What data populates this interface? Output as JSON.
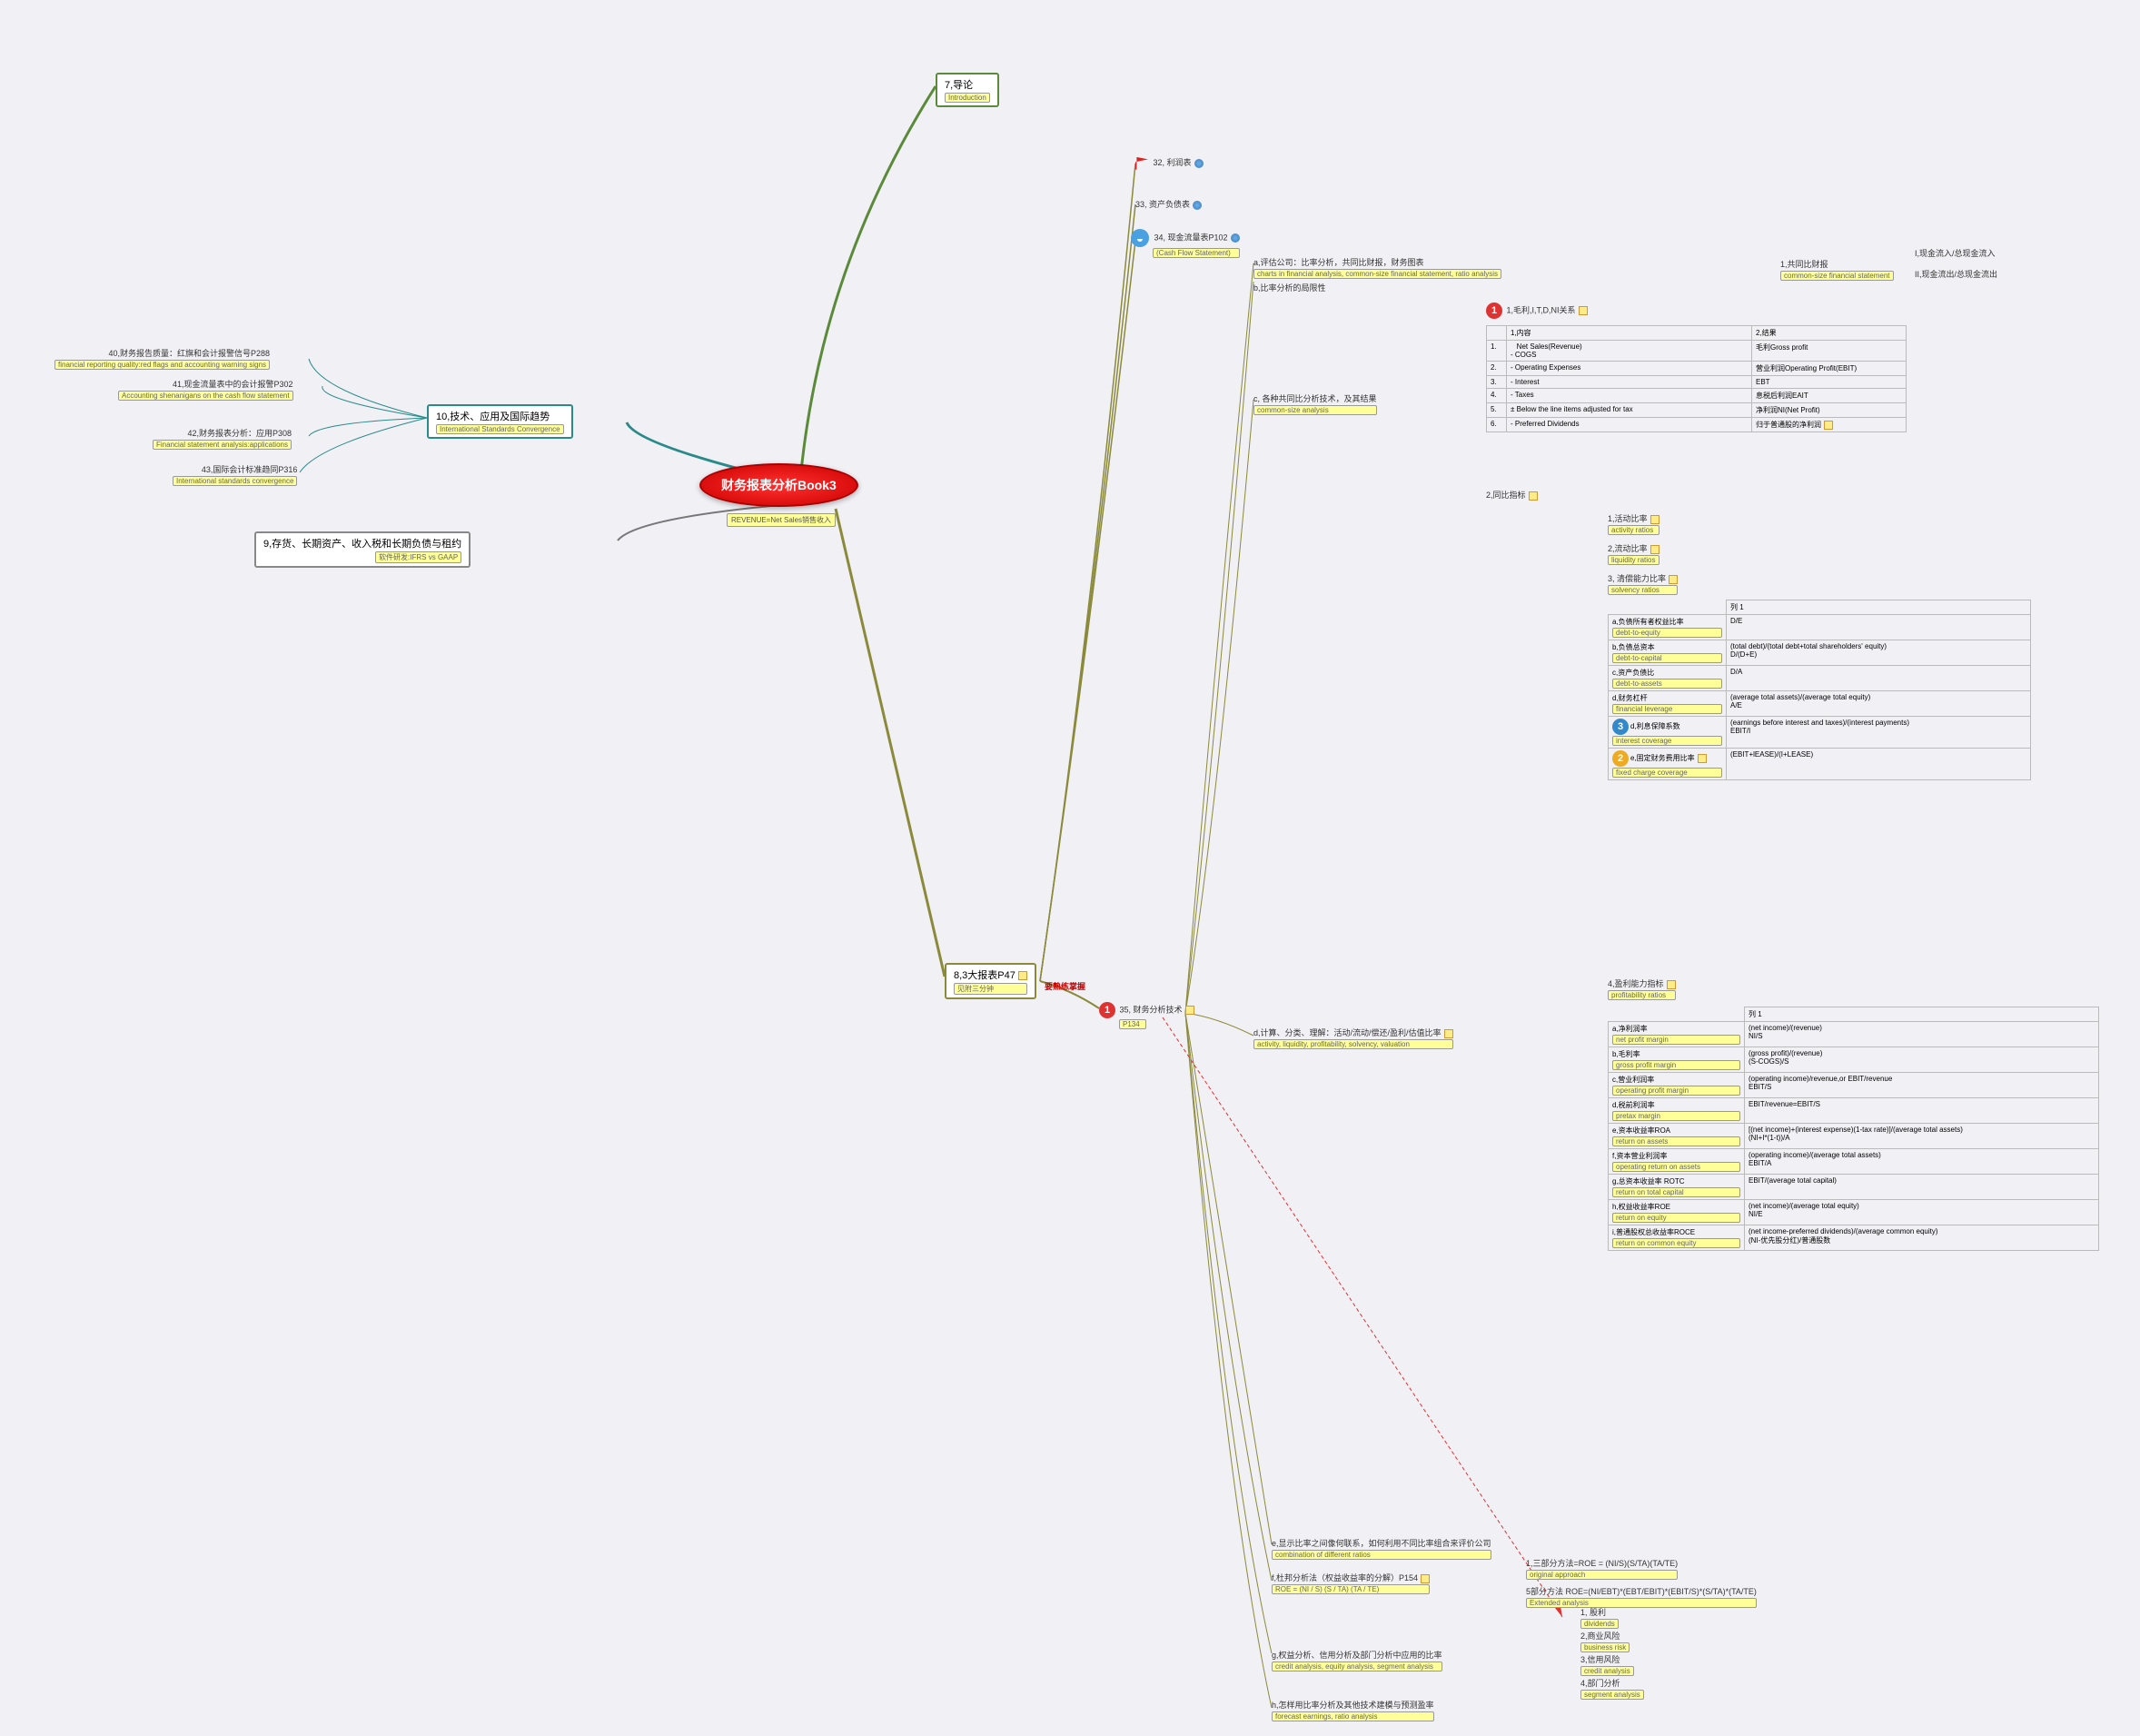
{
  "center": {
    "title": "财务报表分析Book3",
    "subtitle": "REVENUE=Net Sales销售收入"
  },
  "branch7": {
    "title": "7,导论",
    "sub": "Introduction"
  },
  "branch8": {
    "title": "8,3大报表P47",
    "sub": "见附三分钟",
    "annotation": "要熟练掌握"
  },
  "branch9": {
    "title": "9,存货、长期资产、收入税和长期负债与租约",
    "sub": "软件研发:IFRS vs GAAP"
  },
  "branch10": {
    "title": "10,技术、应用及国际趋势",
    "sub": "International Standards Convergence"
  },
  "b10_items": [
    {
      "t": "40,财务报告质量：红旗和会计报警信号P288",
      "s": "financial reporting quality:red flags and accounting warning signs"
    },
    {
      "t": "41,现金流量表中的会计报警P302",
      "s": "Accounting shenanigans on the cash flow statement"
    },
    {
      "t": "42,财务报表分析：应用P308",
      "s": "Financial statement analysis:applications"
    },
    {
      "t": "43,国际会计标准趋同P316",
      "s": "International standards convergence"
    }
  ],
  "b8_items": {
    "32": "32, 利润表",
    "33": "33, 资产负债表",
    "34": {
      "t": "34, 现金流量表P102",
      "s": "(Cash Flow Statement)"
    },
    "35": {
      "t": "35, 财务分析技术",
      "s": "P134"
    }
  },
  "n35_a": {
    "t": "a,评估公司：比率分析，共同比财报，财务图表",
    "s": "charts in financial analysis, common-size financial statement, ratio analysis"
  },
  "n35_a1": {
    "t": "1,共同比财报",
    "s": "common-size financial statement"
  },
  "n35_a1_I": "I,现金流入/总现金流入",
  "n35_a1_II": "II,现金流出/总现金流出",
  "n35_b": "b,比率分析的局限性",
  "n35_c": {
    "t": "c, 各种共同比分析技术，及其结果",
    "s": "common-size analysis"
  },
  "n35_c1": {
    "t": "1,毛利,I,T,D,NI关系"
  },
  "table1": {
    "headers": [
      "1,内容",
      "2,结果"
    ],
    "rows": [
      [
        "1.",
        "Net Sales(Revenue)\n- COGS",
        "毛利Gross profit"
      ],
      [
        "2.",
        "- Operating Expenses",
        "营业利润Operating Profit(EBIT)"
      ],
      [
        "3.",
        "- Interest",
        "EBT"
      ],
      [
        "4.",
        "- Taxes",
        "息税后利润EAIT"
      ],
      [
        "5.",
        "± Below the line items adjusted for tax",
        "净利润NI(Net Profit)"
      ],
      [
        "6.",
        "- Preferred Dividends",
        "归于普通股的净利润"
      ]
    ]
  },
  "n35_c2": "2,同比指标",
  "ratios_nav": [
    {
      "t": "1,活动比率",
      "s": "activity ratios"
    },
    {
      "t": "2,流动比率",
      "s": "liquidity ratios"
    },
    {
      "t": "3, 清偿能力比率",
      "s": "solvency ratios"
    },
    {
      "t": "4,盈利能力指标",
      "s": "profitability ratios"
    }
  ],
  "solvency_table": {
    "header": "列 1",
    "rows": [
      {
        "n": "a,负债所有者权益比率",
        "s": "debt-to-equity",
        "v": "D/E"
      },
      {
        "n": "b,负债总资本",
        "s": "debt-to-capital",
        "v": "(total debt)/(total debt+total shareholders' equity)\nD/(D+E)"
      },
      {
        "n": "c,资产负债比",
        "s": "debt-to-assets",
        "v": "D/A"
      },
      {
        "n": "d,财务杠杆",
        "s": "financial leverage",
        "v": "(average total assets)/(average total equity)\nA/E"
      },
      {
        "n": "d,利息保障系数",
        "s": "interest coverage",
        "v": "(earnings before interest and taxes)/(interest payments)\nEBIT/I",
        "icon": "3"
      },
      {
        "n": "e,固定财务费用比率",
        "s": "fixed charge coverage",
        "v": "(EBIT+lEASE)/(I+LEASE)",
        "icon": "2"
      }
    ]
  },
  "profit_table": {
    "header": "列 1",
    "rows": [
      {
        "n": "a,净利润率",
        "s": "net profit margin",
        "v": "(net income)/(revenue)\nNI/S"
      },
      {
        "n": "b,毛利率",
        "s": "gross profit margin",
        "v": "(gross profit)/(revenue)\n(S-COGS)/S"
      },
      {
        "n": "c,营业利润率",
        "s": "operating profit margin",
        "v": "(operating income)/revenue,or EBIT/revenue\nEBIT/S"
      },
      {
        "n": "d,税前利润率",
        "s": "pretax margin",
        "v": "EBIT/revenue=EBIT/S"
      },
      {
        "n": "e,资本收益率ROA",
        "s": "return on assets",
        "v": "[(net income)+(interest expense)(1-tax rate)]/(average total assets)\n(NI+I*(1-t))/A"
      },
      {
        "n": "f,资本营业利润率",
        "s": "operating return on assets",
        "v": "(operating income)/(average total assets)\nEBIT/A"
      },
      {
        "n": "g,总资本收益率 ROTC",
        "s": "return on total capital",
        "v": "EBIT/(average total capital)"
      },
      {
        "n": "h,权益收益率ROE",
        "s": "return on equity",
        "v": "(net income)/(average total equity)\nNI/E"
      },
      {
        "n": "i,普通股权总收益率ROCE",
        "s": "return on common equity",
        "v": "(net income-preferred dividends)/(average common equity)\n(NI-优先股分红)/普通股数"
      }
    ]
  },
  "n35_d": {
    "t": "d,计算、分类、理解：活动/流动/偿还/盈利/估值比率",
    "s": "activity, liquidity, profitability, solvency, valuation"
  },
  "n35_e": {
    "t": "e,显示比率之间像何联系，如何利用不同比率组合来评价公司",
    "s": "combination of different ratios"
  },
  "n35_f": {
    "t": "f,杜邦分析法（权益收益率的分解）P154",
    "s": "ROE = (NI / S) (S / TA) (TA / TE)"
  },
  "n35_f1": {
    "t": "1,三部分方法=ROE = (NI/S)(S/TA)(TA/TE)",
    "s": "original approach"
  },
  "n35_f2": {
    "t": "5部分方法   ROE=(NI/EBT)*(EBT/EBIT)*(EBIT/S)*(S/TA)*(TA/TE)",
    "s": "Extended analysis"
  },
  "n35_f2_items": [
    {
      "t": "1, 股利",
      "s": "dividends"
    },
    {
      "t": "2,商业风险",
      "s": "business risk"
    },
    {
      "t": "3,信用风险",
      "s": "credit analysis"
    },
    {
      "t": "4,部门分析",
      "s": "segment analysis"
    }
  ],
  "n35_g": {
    "t": "g,权益分析、信用分析及部门分析中应用的比率",
    "s": "credit analysis, equity analysis, segment analysis"
  },
  "n35_h": {
    "t": "h,怎样用比率分析及其他技术建模与预测盈率",
    "s": "forecast earnings, ratio analysis"
  }
}
